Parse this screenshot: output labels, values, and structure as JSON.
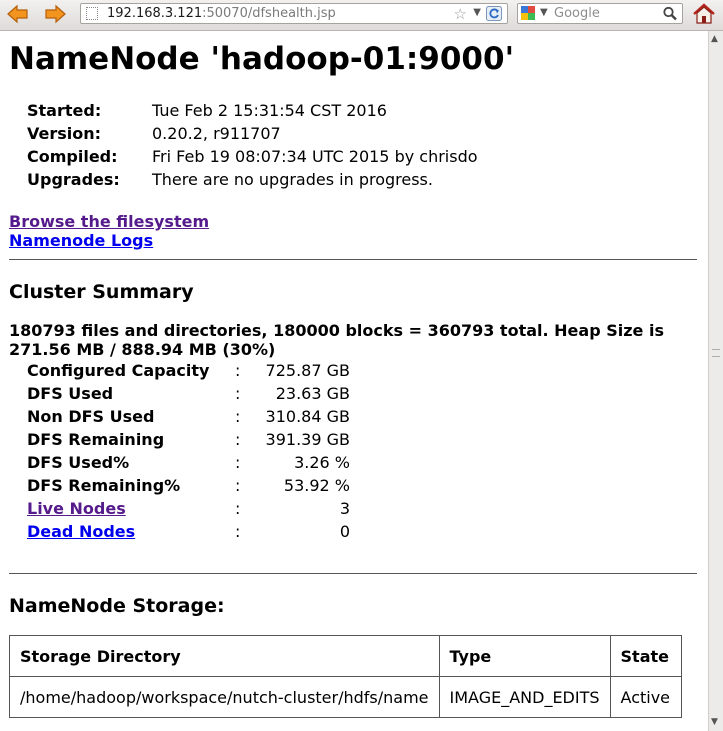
{
  "browser": {
    "url_host": "192.168.3.121",
    "url_path": ":50070/dfshealth.jsp",
    "search_placeholder": "Google"
  },
  "page": {
    "title": "NameNode 'hadoop-01:9000'",
    "info": [
      {
        "label": "Started:",
        "value": "Tue Feb 2 15:31:54 CST 2016"
      },
      {
        "label": "Version:",
        "value": "0.20.2, r911707"
      },
      {
        "label": "Compiled:",
        "value": "Fri Feb 19 08:07:34 UTC 2015 by chrisdo"
      },
      {
        "label": "Upgrades:",
        "value": "There are no upgrades in progress."
      }
    ],
    "links": {
      "browse": "Browse the filesystem",
      "logs": "Namenode Logs"
    },
    "cluster": {
      "heading": "Cluster Summary",
      "heap": "180793 files and directories, 180000 blocks = 360793 total. Heap Size is 271.56 MB / 888.94 MB (30%)",
      "separator": ":",
      "rows": [
        {
          "label": "Configured Capacity",
          "value": "725.87 GB"
        },
        {
          "label": "DFS Used",
          "value": "23.63 GB"
        },
        {
          "label": "Non DFS Used",
          "value": "310.84 GB"
        },
        {
          "label": "DFS Remaining",
          "value": "391.39 GB"
        },
        {
          "label": "DFS Used%",
          "value": "3.26 %"
        },
        {
          "label": "DFS Remaining%",
          "value": "53.92 %"
        },
        {
          "label": "Live Nodes",
          "value": "3"
        },
        {
          "label": "Dead Nodes",
          "value": "0"
        }
      ]
    },
    "storage": {
      "heading": "NameNode Storage:",
      "headers": [
        "Storage Directory",
        "Type",
        "State"
      ],
      "rows": [
        [
          "/home/hadoop/workspace/nutch-cluster/hdfs/name",
          "IMAGE_AND_EDITS",
          "Active"
        ]
      ]
    }
  },
  "colors": {
    "visited_link": "#551a8b",
    "link": "#0000ee",
    "nav_arrow": "#f08a24"
  }
}
